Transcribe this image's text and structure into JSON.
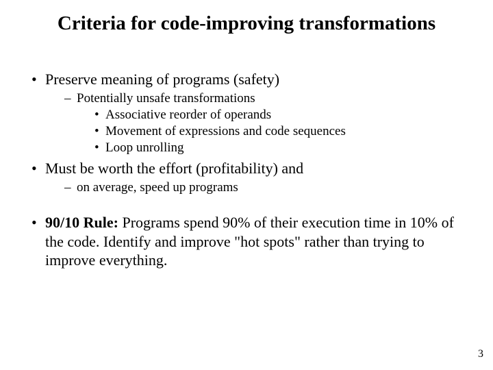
{
  "title": "Criteria for code-improving transformations",
  "bullets": {
    "b1": "Preserve meaning of programs (safety)",
    "b1_1": "Potentially unsafe transformations",
    "b1_1_1": "Associative reorder of operands",
    "b1_1_2": "Movement of expressions and code sequences",
    "b1_1_3": "Loop unrolling",
    "b2": "Must be worth the effort (profitability) and",
    "b2_1": "on average, speed up programs",
    "b3_bold": "90/10 Rule:",
    "b3_rest": " Programs spend 90% of their execution time in 10% of the code. Identify and improve \"hot spots\" rather than trying to improve everything."
  },
  "page_number": "3"
}
